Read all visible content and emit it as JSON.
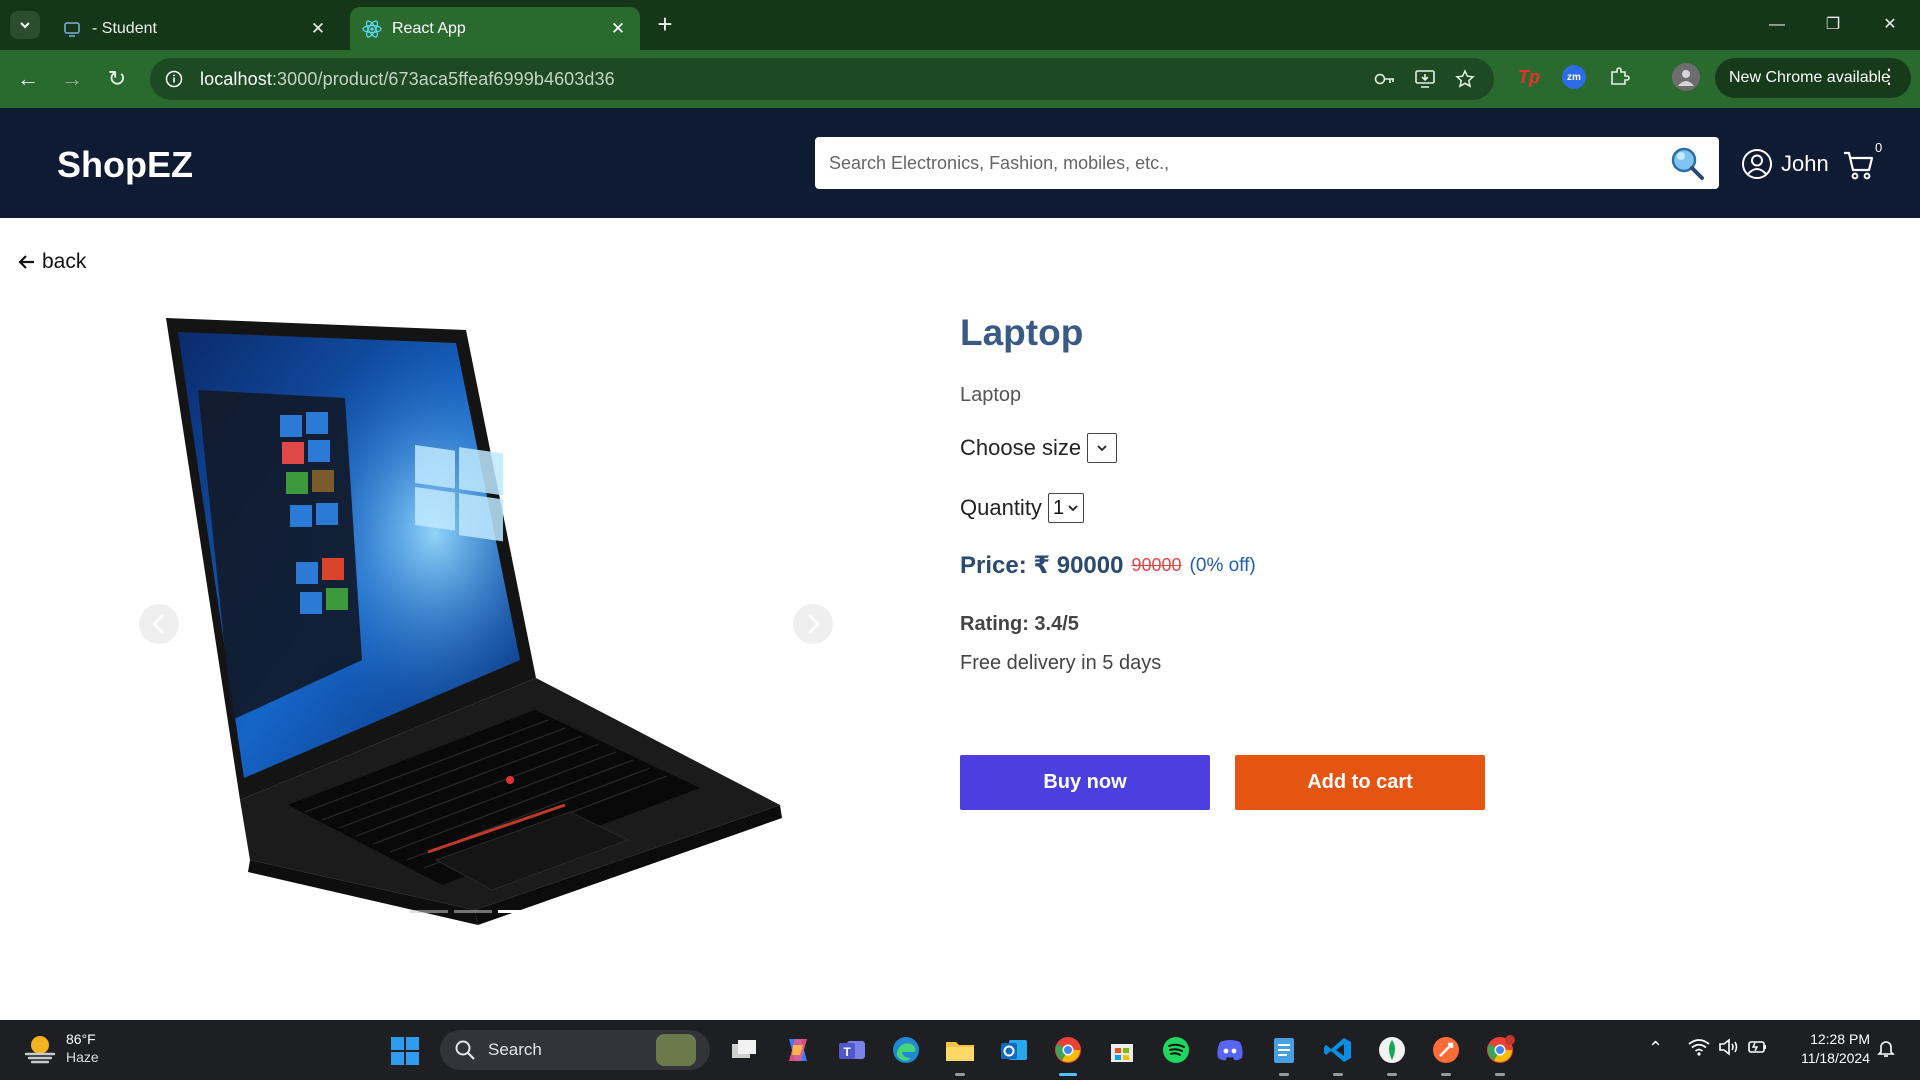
{
  "browser": {
    "tabs": [
      {
        "title": "- Student",
        "active": false
      },
      {
        "title": "React App",
        "active": true
      }
    ],
    "url_host": "localhost",
    "url_rest": ":3000/product/673aca5ffeaf6999b4603d36",
    "update_label": "New Chrome available"
  },
  "header": {
    "brand": "ShopEZ",
    "search_placeholder": "Search Electronics, Fashion, mobiles, etc.,",
    "user_name": "John",
    "cart_count": "0"
  },
  "page": {
    "back_label": "back"
  },
  "product": {
    "title": "Laptop",
    "description": "Laptop",
    "size_label": "Choose size",
    "quantity_label": "Quantity",
    "quantity_value": "1",
    "price_label": "Price: ₹ 90000",
    "original_price": "90000",
    "discount_label": "(0% off)",
    "rating_label": "Rating: 3.4/5",
    "delivery_label": "Free delivery in 5 days",
    "carousel_active_index": 2,
    "carousel_slide_count": 3
  },
  "actions": {
    "buy_now": "Buy now",
    "add_to_cart": "Add to cart"
  },
  "taskbar": {
    "temperature": "86°F",
    "weather": "Haze",
    "search_label": "Search",
    "time": "12:28 PM",
    "date": "11/18/2024"
  },
  "colors": {
    "header_bg": "#0f1b33",
    "buy_now": "#4b3fe0",
    "add_to_cart": "#e65412",
    "title": "#3a5a86"
  }
}
